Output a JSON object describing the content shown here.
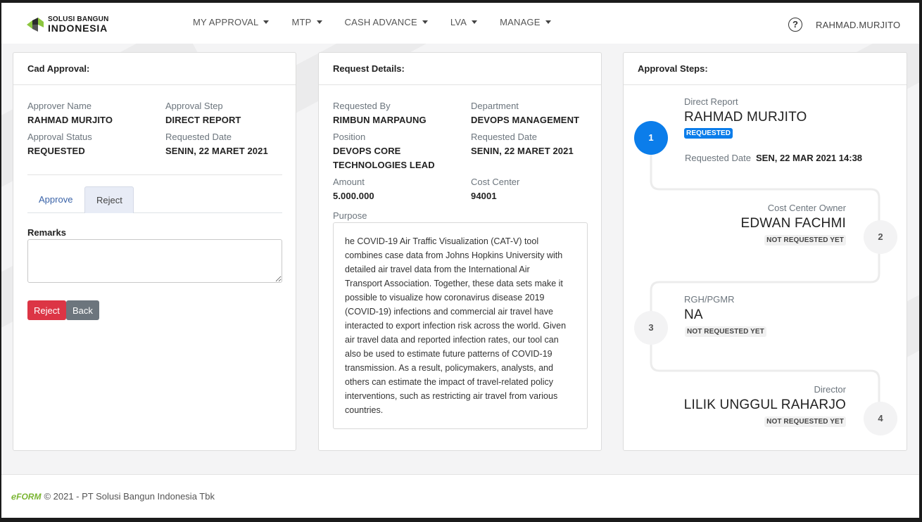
{
  "brand": {
    "line1": "SOLUSI BANGUN",
    "line2": "INDONESIA"
  },
  "nav": {
    "items": [
      "MY APPROVAL",
      "MTP",
      "CASH ADVANCE",
      "LVA",
      "MANAGE"
    ],
    "help_icon": "?",
    "user": "RAHMAD.MURJITO"
  },
  "cad": {
    "title": "Cad Approval:",
    "approver_name_label": "Approver Name",
    "approver_name": "RAHMAD MURJITO",
    "approval_step_label": "Approval Step",
    "approval_step": "DIRECT REPORT",
    "approval_status_label": "Approval Status",
    "approval_status": "REQUESTED",
    "requested_date_label": "Requested Date",
    "requested_date": "SENIN, 22 MARET 2021",
    "tabs": [
      "Approve",
      "Reject"
    ],
    "active_tab": "Reject",
    "remarks_label": "Remarks",
    "remarks_value": "",
    "reject_button": "Reject",
    "back_button": "Back"
  },
  "details": {
    "title": "Request Details:",
    "requested_by_label": "Requested By",
    "requested_by": "RIMBUN MARPAUNG",
    "department_label": "Department",
    "department": "DEVOPS MANAGEMENT",
    "position_label": "Position",
    "position_line1": "DEVOPS CORE",
    "position_line2": "TECHNOLOGIES LEAD",
    "requested_date_label": "Requested Date",
    "requested_date": "SENIN, 22 MARET 2021",
    "amount_label": "Amount",
    "amount": "5.000.000",
    "cost_center_label": "Cost Center",
    "cost_center": "94001",
    "purpose_label": "Purpose",
    "purpose_lines": [
      "he COVID-19 Air Traffic Visualization (CAT-V) tool",
      "combines case data from Johns Hopkins University with",
      "detailed air travel data from the International Air",
      "Transport Association. Together, these data sets make it",
      "possible to visualize how coronavirus disease 2019",
      "(COVID-19) infections and commercial air travel have",
      "interacted to export infection risk across the world. Given",
      "air travel data and reported infection rates, our tool can",
      "also be used to estimate future patterns of COVID-19",
      "transmission. As a result, policymakers, analysts, and",
      "others can estimate the impact of travel-related policy",
      "interventions, such as restricting air travel from various",
      "countries."
    ]
  },
  "steps": {
    "title": "Approval Steps:",
    "requested_date_label": "Requested Date",
    "items": [
      {
        "number": "1",
        "role": "Direct Report",
        "name": "RAHMAD MURJITO",
        "status": "REQUESTED",
        "requested_date": "SEN, 22 MAR 2021 14:38"
      },
      {
        "number": "2",
        "role": "Cost Center Owner",
        "name": "EDWAN FACHMI",
        "status": "NOT REQUESTED YET"
      },
      {
        "number": "3",
        "role": "RGH/PGMR",
        "name": "NA",
        "status": "NOT REQUESTED YET"
      },
      {
        "number": "4",
        "role": "Director",
        "name": "LILIK UNGGUL RAHARJO",
        "status": "NOT REQUESTED YET"
      }
    ]
  },
  "footer": {
    "logo": "FORM",
    "text": "© 2021 - PT Solusi Bangun Indonesia Tbk"
  },
  "colors": {
    "primary": "#0b7dea",
    "danger": "#dc3545",
    "secondary": "#6c757d",
    "link": "#3a63a8",
    "eform_green": "#7ab532"
  }
}
